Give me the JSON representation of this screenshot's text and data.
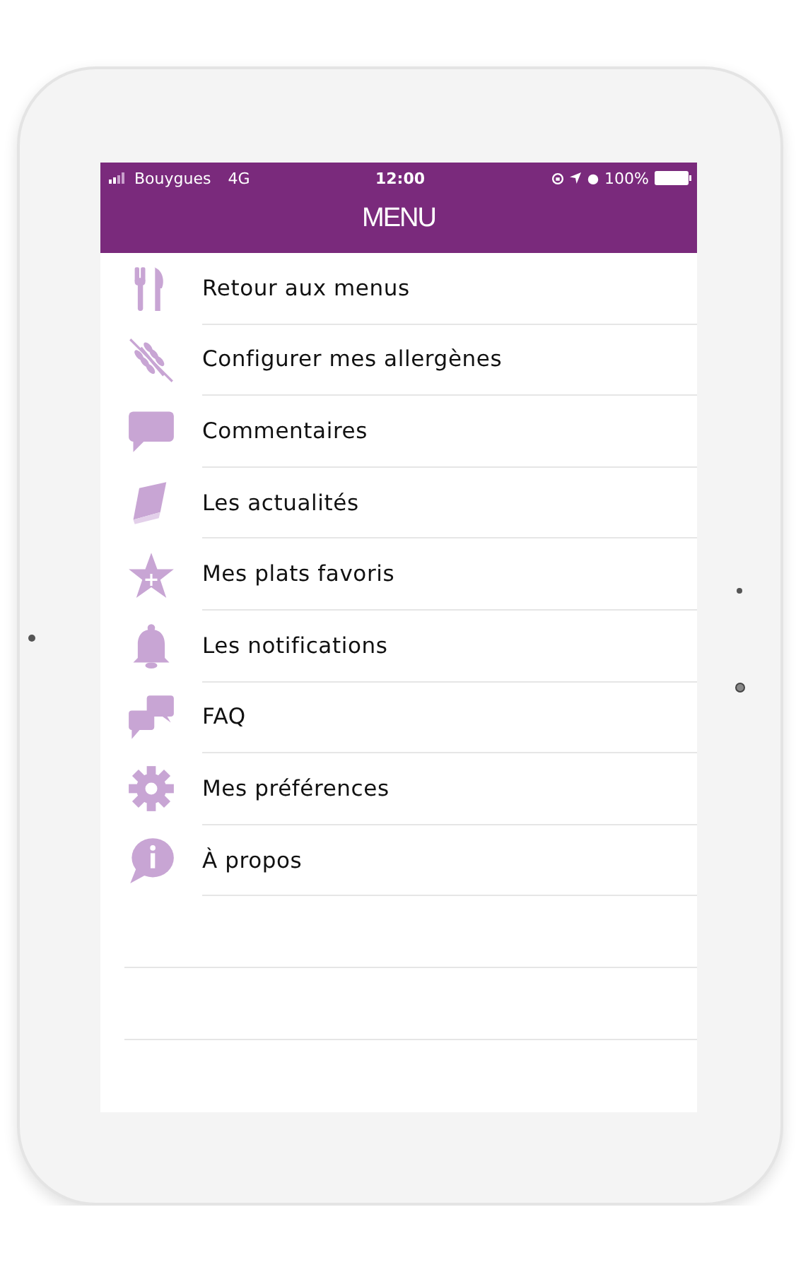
{
  "status_bar": {
    "carrier": "Bouygues",
    "network": "4G",
    "time": "12:00",
    "battery": "100%"
  },
  "header": {
    "title": "MENU"
  },
  "items": [
    {
      "label": "Retour aux menus"
    },
    {
      "label": "Configurer mes allergènes"
    },
    {
      "label": "Commentaires"
    },
    {
      "label": "Les actualités"
    },
    {
      "label": "Mes plats favoris"
    },
    {
      "label": "Les notifications"
    },
    {
      "label": "FAQ"
    },
    {
      "label": "Mes préférences"
    },
    {
      "label": "À propos"
    }
  ]
}
